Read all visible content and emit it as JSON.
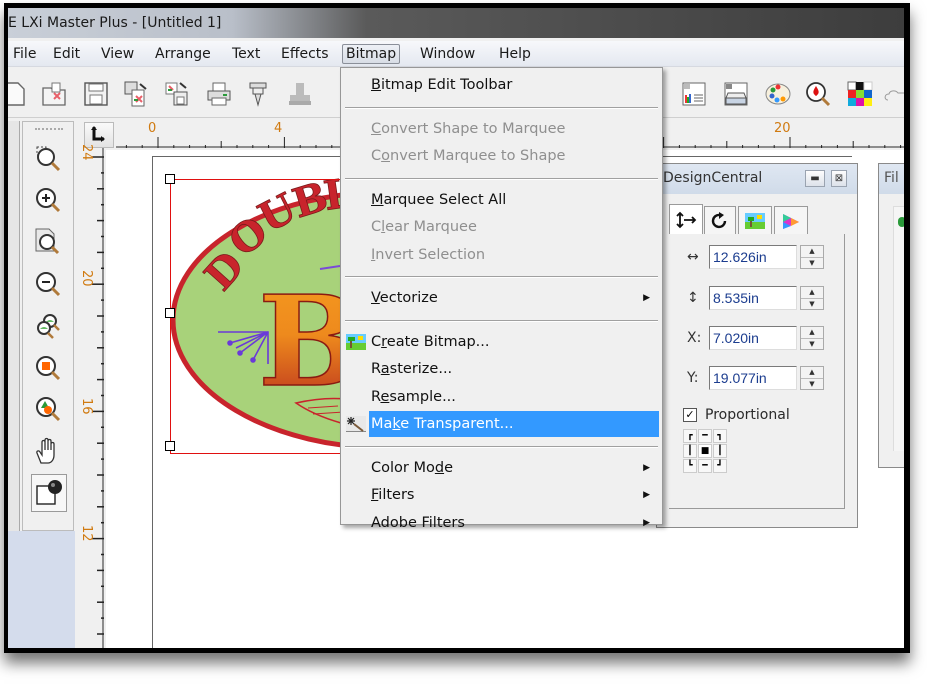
{
  "window": {
    "title": "E LXi Master Plus - [Untitled 1]"
  },
  "menubar": {
    "items": [
      {
        "label": "File"
      },
      {
        "label": "Edit"
      },
      {
        "label": "View"
      },
      {
        "label": "Arrange"
      },
      {
        "label": "Text"
      },
      {
        "label": "Effects"
      },
      {
        "label": "Bitmap",
        "open": true
      },
      {
        "label": "Window"
      },
      {
        "label": "Help"
      }
    ]
  },
  "toolbar": {
    "icons": [
      "new-document-icon",
      "open-folder-icon",
      "save-icon",
      "import-icon",
      "export-icon",
      "print-icon",
      "plot-icon",
      "stamp-icon",
      "design-central-icon",
      "production-manager-icon",
      "palette-icon",
      "color-picker-icon",
      "swatch-grid-icon",
      "cloud-icon"
    ]
  },
  "bitmap_menu": {
    "items": [
      {
        "label": "Bitmap Edit Toolbar",
        "mnemonic": "B",
        "enabled": true
      },
      {
        "separator": true
      },
      {
        "label": "Convert Shape to Marquee",
        "mnemonic": "C",
        "enabled": false
      },
      {
        "label": "Convert Marquee to Shape",
        "mnemonic": "o",
        "enabled": false
      },
      {
        "separator": true
      },
      {
        "label": "Marquee Select All",
        "mnemonic": "M",
        "enabled": true
      },
      {
        "label": "Clear Marquee",
        "mnemonic": "l",
        "enabled": false
      },
      {
        "label": "Invert Selection",
        "mnemonic": "I",
        "enabled": false
      },
      {
        "separator": true
      },
      {
        "label": "Vectorize",
        "mnemonic": "V",
        "enabled": true,
        "submenu": true
      },
      {
        "separator": true
      },
      {
        "label": "Create Bitmap...",
        "mnemonic": "r",
        "enabled": true,
        "icon": "create-bitmap-icon"
      },
      {
        "label": "Rasterize...",
        "mnemonic": "a",
        "enabled": true
      },
      {
        "label": "Resample...",
        "mnemonic": "e",
        "enabled": true
      },
      {
        "label": "Make Transparent...",
        "mnemonic": "k",
        "enabled": true,
        "highlighted": true,
        "icon": "magic-wand-icon"
      },
      {
        "separator": true
      },
      {
        "label": "Color Mode",
        "mnemonic": "d",
        "enabled": true,
        "submenu": true
      },
      {
        "label": "Filters",
        "mnemonic": "F",
        "enabled": true,
        "submenu": true
      },
      {
        "label": "Adobe Filters",
        "mnemonic": "",
        "enabled": true,
        "submenu": true
      }
    ]
  },
  "rulers": {
    "horizontal_labels": [
      "0",
      "4",
      "20"
    ],
    "vertical_labels": [
      "24",
      "20",
      "16",
      "12"
    ],
    "units": "in"
  },
  "tools": [
    {
      "name": "zoom-marquee-icon"
    },
    {
      "name": "zoom-in-icon"
    },
    {
      "name": "zoom-page-icon"
    },
    {
      "name": "zoom-out-icon"
    },
    {
      "name": "zoom-all-icon"
    },
    {
      "name": "zoom-selected-icon"
    },
    {
      "name": "zoom-objects-icon"
    },
    {
      "name": "pan-hand-icon"
    },
    {
      "name": "shape-color-icon"
    }
  ],
  "design_central": {
    "title": "DesignCentral",
    "tabs": [
      "size-position-tab",
      "rotate-tab",
      "bitmap-tab",
      "color-tab"
    ],
    "width": {
      "label": "↔",
      "value": "12.626in"
    },
    "height": {
      "label": "↕",
      "value": "8.535in"
    },
    "x": {
      "label": "X:",
      "value": "7.020in"
    },
    "y": {
      "label": "Y:",
      "value": "19.077in"
    },
    "proportional": {
      "label": "Proportional",
      "checked": true
    }
  },
  "second_panel": {
    "title": "Fil"
  },
  "artwork": {
    "arc_text": "DOUBLE",
    "big_letter": "B"
  },
  "colors": {
    "menu_highlight": "#3399ff",
    "selection_red": "#e01010",
    "oval_fill": "#a8d27a",
    "oval_border": "#c8242c",
    "letter_top": "#f59a1f",
    "letter_bottom": "#b62a1e",
    "ruler_number": "#d07a10"
  }
}
